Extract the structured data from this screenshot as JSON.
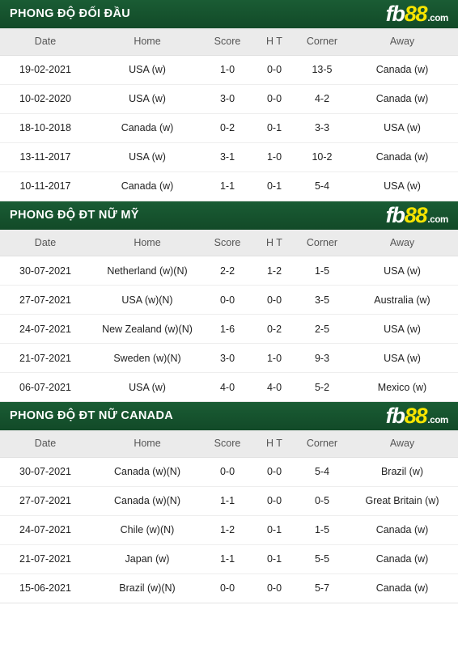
{
  "brand": {
    "logo_fb": "fb",
    "logo_88": "88",
    "logo_dotcom": ".com",
    "bar_color": "#14532d",
    "logo_yellow": "#f5e400"
  },
  "columns": {
    "date": "Date",
    "home": "Home",
    "score": "Score",
    "ht": "H T",
    "corner": "Corner",
    "away": "Away"
  },
  "colors": {
    "usa": "#e8743b",
    "canada": "#4a90c2",
    "score": "#c0392b",
    "neutral": "#222222"
  },
  "sections": [
    {
      "title": "PHONG ĐỘ ĐỐI ĐẦU",
      "rows": [
        {
          "date": "19-02-2021",
          "home": "USA (w)",
          "home_style": "t-usa",
          "score": "1-0",
          "ht": "0-0",
          "corner": "13-5",
          "away": "Canada (w)",
          "away_style": "t-canada"
        },
        {
          "date": "10-02-2020",
          "home": "USA (w)",
          "home_style": "t-usa",
          "score": "3-0",
          "ht": "0-0",
          "corner": "4-2",
          "away": "Canada (w)",
          "away_style": "t-canada"
        },
        {
          "date": "18-10-2018",
          "home": "Canada (w)",
          "home_style": "t-canada",
          "score": "0-2",
          "ht": "0-1",
          "corner": "3-3",
          "away": "USA (w)",
          "away_style": "t-usa"
        },
        {
          "date": "13-11-2017",
          "home": "USA (w)",
          "home_style": "t-usa",
          "score": "3-1",
          "ht": "1-0",
          "corner": "10-2",
          "away": "Canada (w)",
          "away_style": "t-canada"
        },
        {
          "date": "10-11-2017",
          "home": "Canada (w)",
          "home_style": "t-canada",
          "score": "1-1",
          "ht": "0-1",
          "corner": "5-4",
          "away": "USA (w)",
          "away_style": "t-usa"
        }
      ]
    },
    {
      "title": "PHONG ĐỘ ĐT NỮ MỸ",
      "rows": [
        {
          "date": "30-07-2021",
          "home": "Netherland (w)(N)",
          "home_style": "t-plain",
          "score": "2-2",
          "ht": "1-2",
          "corner": "1-5",
          "away": "USA (w)",
          "away_style": "t-usa"
        },
        {
          "date": "27-07-2021",
          "home": "USA (w)(N)",
          "home_style": "t-usa",
          "score": "0-0",
          "ht": "0-0",
          "corner": "3-5",
          "away": "Australia (w)",
          "away_style": "t-plain"
        },
        {
          "date": "24-07-2021",
          "home": "New Zealand (w)(N)",
          "home_style": "t-plain",
          "score": "1-6",
          "ht": "0-2",
          "corner": "2-5",
          "away": "USA (w)",
          "away_style": "t-usa"
        },
        {
          "date": "21-07-2021",
          "home": "Sweden (w)(N)",
          "home_style": "t-plain",
          "score": "3-0",
          "ht": "1-0",
          "corner": "9-3",
          "away": "USA (w)",
          "away_style": "t-usa"
        },
        {
          "date": "06-07-2021",
          "home": "USA (w)",
          "home_style": "t-usa",
          "score": "4-0",
          "ht": "4-0",
          "corner": "5-2",
          "away": "Mexico (w)",
          "away_style": "t-plain"
        }
      ]
    },
    {
      "title": "PHONG ĐỘ ĐT NỮ CANADA",
      "rows": [
        {
          "date": "30-07-2021",
          "home": "Canada (w)(N)",
          "home_style": "t-canada",
          "score": "0-0",
          "ht": "0-0",
          "corner": "5-4",
          "away": "Brazil (w)",
          "away_style": "t-plain"
        },
        {
          "date": "27-07-2021",
          "home": "Canada (w)(N)",
          "home_style": "t-canada",
          "score": "1-1",
          "ht": "0-0",
          "corner": "0-5",
          "away": "Great Britain (w)",
          "away_style": "t-plain"
        },
        {
          "date": "24-07-2021",
          "home": "Chile (w)(N)",
          "home_style": "t-plain",
          "score": "1-2",
          "ht": "0-1",
          "corner": "1-5",
          "away": "Canada (w)",
          "away_style": "t-canada"
        },
        {
          "date": "21-07-2021",
          "home": "Japan (w)",
          "home_style": "t-plain",
          "score": "1-1",
          "ht": "0-1",
          "corner": "5-5",
          "away": "Canada (w)",
          "away_style": "t-canada"
        },
        {
          "date": "15-06-2021",
          "home": "Brazil (w)(N)",
          "home_style": "t-plain",
          "score": "0-0",
          "ht": "0-0",
          "corner": "5-7",
          "away": "Canada (w)",
          "away_style": "t-canada"
        }
      ]
    }
  ]
}
